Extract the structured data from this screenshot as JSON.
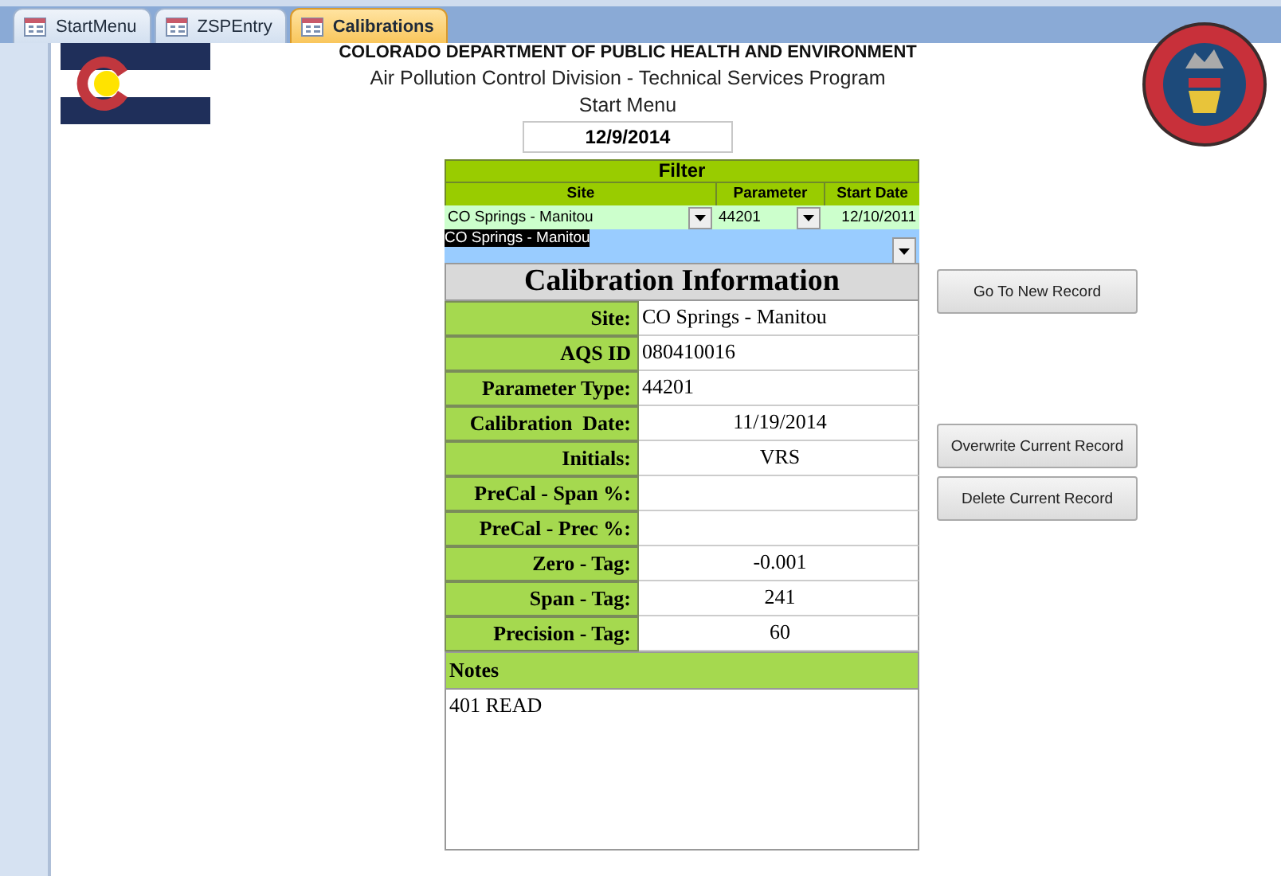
{
  "tabs": [
    {
      "label": "StartMenu",
      "selected": false
    },
    {
      "label": "ZSPEntry",
      "selected": false
    },
    {
      "label": "Calibrations",
      "selected": true
    }
  ],
  "header": {
    "department": "COLORADO DEPARTMENT OF PUBLIC HEALTH AND ENVIRONMENT",
    "division": "Air Pollution Control Division - Technical Services Program",
    "menu_title": "Start Menu",
    "date": "12/9/2014"
  },
  "filter": {
    "title": "Filter",
    "columns": [
      "Site",
      "Parameter",
      "Start Date"
    ],
    "site": "CO Springs - Manitou",
    "parameter": "44201",
    "start_date": "12/10/2011",
    "site_list_value": "CO Springs - Manitou"
  },
  "calibration": {
    "title": "Calibration Information",
    "fields": [
      {
        "label": "Site:",
        "value": "CO Springs - Manitou"
      },
      {
        "label": "AQS ID",
        "value": "080410016"
      },
      {
        "label": "Parameter Type:",
        "value": "44201"
      },
      {
        "label": "Calibration  Date:",
        "value": "11/19/2014"
      },
      {
        "label": "Initials:",
        "value": "VRS"
      },
      {
        "label": "PreCal - Span %:"
      },
      {
        "label": "PreCal - Prec %:"
      },
      {
        "label": "Zero - Tag:",
        "value": "-0.001"
      },
      {
        "label": "Span - Tag:",
        "value": "241"
      },
      {
        "label": "Precision - Tag:",
        "value": "60"
      }
    ]
  },
  "notes": {
    "label": "Notes",
    "text": "401 READ"
  },
  "buttons": [
    "Go To New Record",
    "Overwrite Current Record",
    "Delete Current Record"
  ]
}
